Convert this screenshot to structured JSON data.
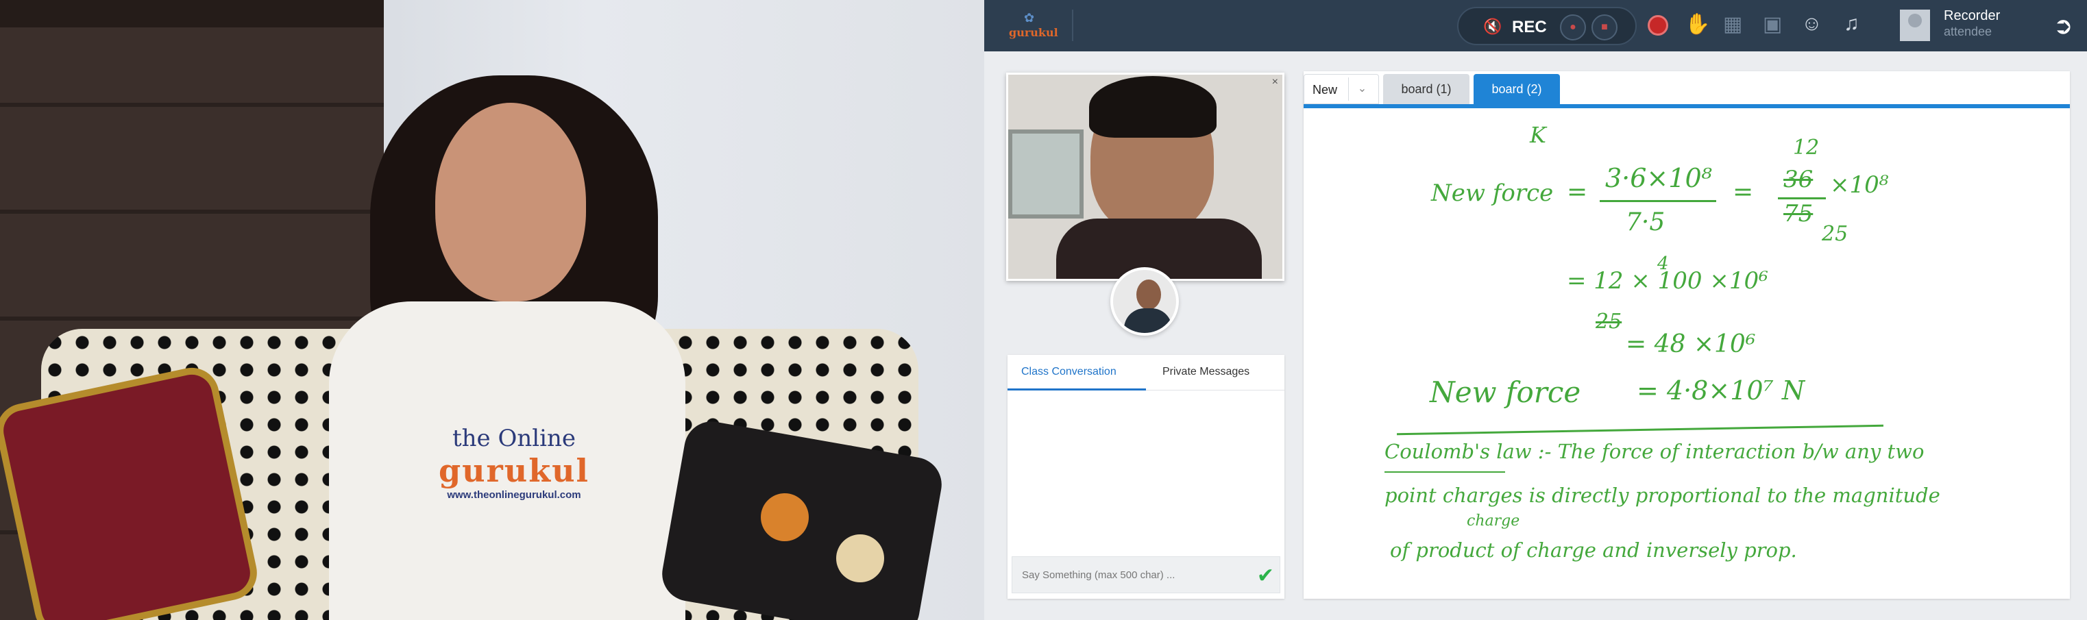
{
  "presenter_shirt": {
    "brand_line1": "the Online",
    "brand_line2": "gurukul",
    "website": "www.theonlinegurukul.com"
  },
  "topbar": {
    "logo_text": "gurukul",
    "rec_label": "REC",
    "user_name": "Recorder",
    "user_role": "attendee",
    "icons": [
      "mute-icon",
      "screen-share-icon",
      "camera-off-icon",
      "record-dot-icon",
      "hand-raise-icon",
      "grid-icon",
      "presentation-icon",
      "participants-icon",
      "bell-icon",
      "logout-icon"
    ],
    "rec_color": "#c62828",
    "bar_color": "#2d3e50"
  },
  "chat": {
    "tab_class": "Class Conversation",
    "tab_private": "Private Messages",
    "input_placeholder": "Say Something (max 500 char) ...",
    "accent": "#1f74c9"
  },
  "board": {
    "new_label": "New",
    "tabs": [
      {
        "label": "board (1)",
        "active": false
      },
      {
        "label": "board (2)",
        "active": true
      }
    ],
    "accent": "#1f84d6",
    "ink_color": "#44a83c",
    "writing": [
      "K",
      "New force",
      "=",
      "3·6×10⁸",
      "7·5",
      "=",
      "12",
      "36",
      "75",
      "×10⁸",
      "25",
      "= 12 × 100 ×10⁶",
      "25",
      "4",
      "= 48 ×10⁶",
      "New force",
      "= 4·8×10⁷ N",
      "Coulomb's law :- The force of interaction b/w any two",
      "point charges is directly proportional to the magnitude",
      "charge",
      "of product of charge and inversely prop."
    ]
  }
}
